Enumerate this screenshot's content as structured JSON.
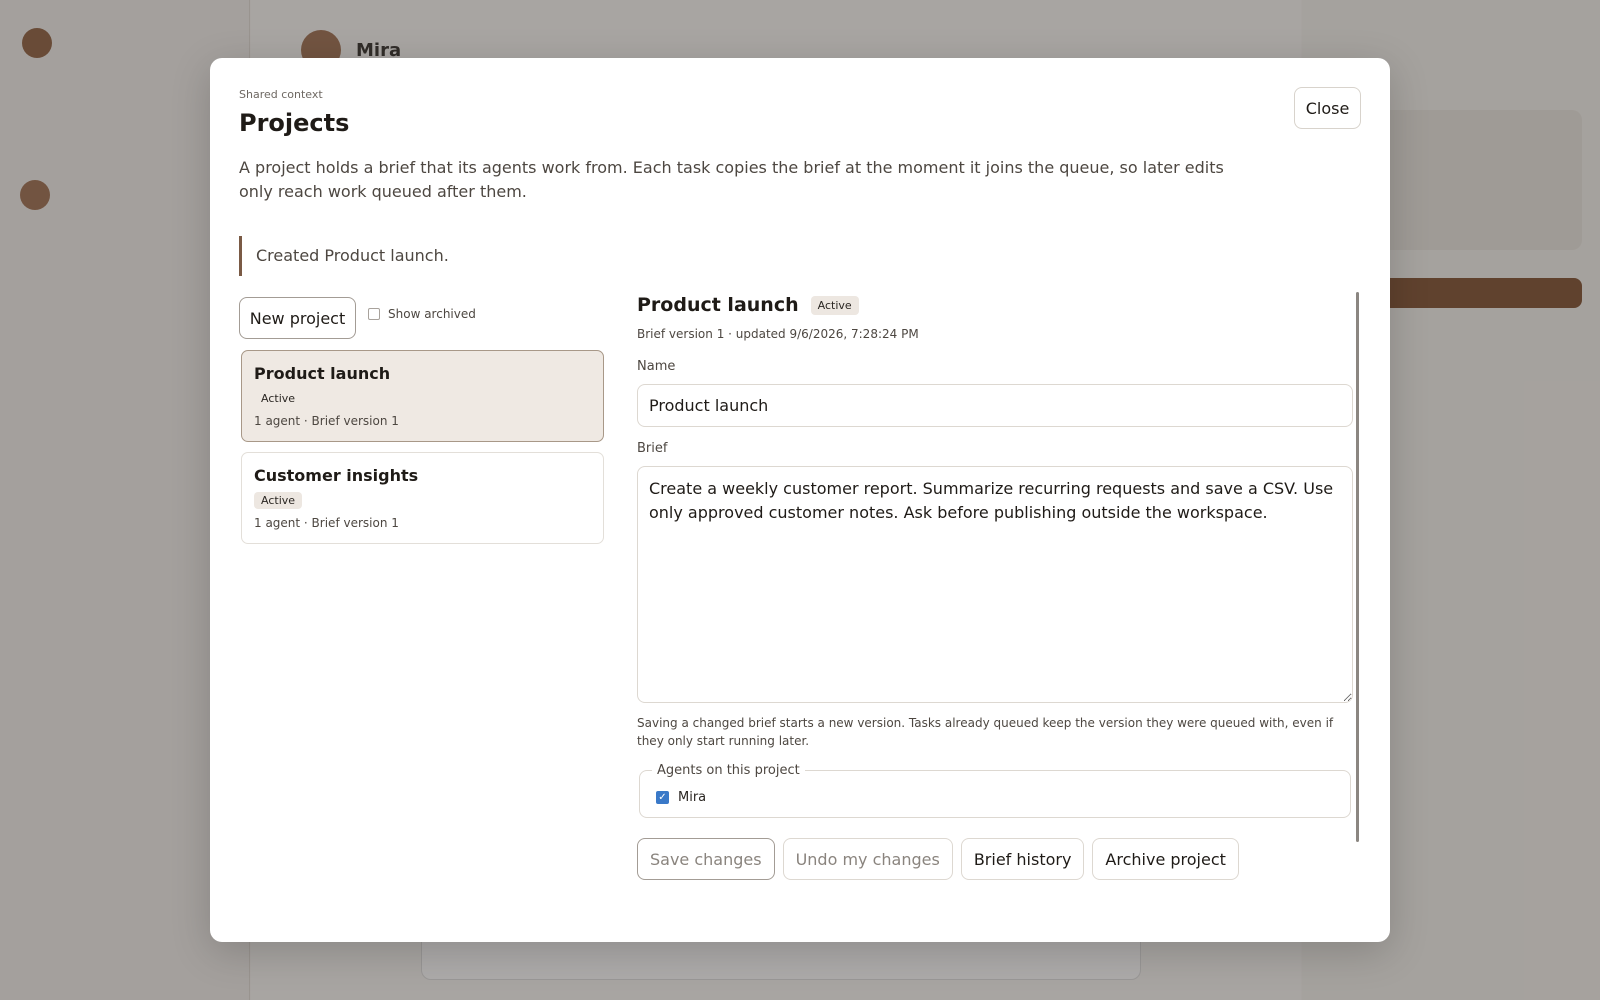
{
  "background": {
    "brand": "",
    "back_label": "",
    "header_agent": "Mira",
    "right_title": ""
  },
  "modal": {
    "eyebrow": "Shared context",
    "title": "Projects",
    "close_label": "Close",
    "intro": "A project holds a brief that its agents work from. Each task copies the brief at the moment it joins the queue, so later edits only reach work queued after them.",
    "notice": "Created Product launch.",
    "new_project_label": "New project",
    "show_archived_label": "Show archived",
    "show_archived_checked": false,
    "projects": [
      {
        "name": "Product launch",
        "status": "Active",
        "meta": "1 agent · Brief version 1",
        "selected": true
      },
      {
        "name": "Customer insights",
        "status": "Active",
        "meta": "1 agent · Brief version 1",
        "selected": false
      }
    ],
    "detail": {
      "title": "Product launch",
      "status": "Active",
      "meta": "Brief version 1 · updated 9/6/2026, 7:28:24 PM",
      "name_label": "Name",
      "name_value": "Product launch",
      "brief_label": "Brief",
      "brief_value": "Create a weekly customer report. Summarize recurring requests and save a CSV. Use only approved customer notes. Ask before publishing outside the workspace.",
      "hint": "Saving a changed brief starts a new version. Tasks already queued keep the version they were queued with, even if they only start running later.",
      "agents_legend": "Agents on this project",
      "agents": [
        {
          "name": "Mira",
          "checked": true
        }
      ],
      "actions": {
        "save": "Save changes",
        "undo": "Undo my changes",
        "history": "Brief history",
        "archive": "Archive project"
      }
    }
  },
  "colors": {
    "accent": "#7a5a45",
    "selected_card": "#efe9e3",
    "checkbox": "#3a79c8"
  }
}
